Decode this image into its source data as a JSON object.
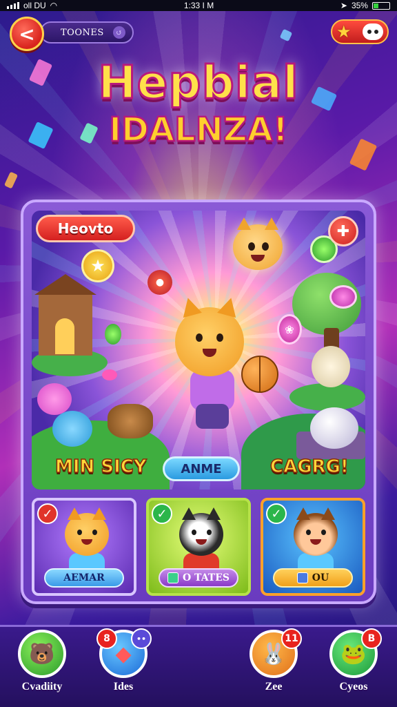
{
  "status_bar": {
    "left_text": "oll DU",
    "time": "1:33 I M",
    "battery": "35%",
    "battery_level": 0.35
  },
  "top_bar": {
    "back_symbol": "<",
    "pill_text": "TOONES",
    "pill_icon": "↺",
    "right_icons": [
      "star-icon",
      "face-icon"
    ]
  },
  "title": {
    "line1": "Hepbial",
    "line2": "IDALNZA!"
  },
  "scene": {
    "badge": "Heovto",
    "labels": {
      "left": "MIN SICY",
      "center": "ANME",
      "right": "CAGRG!"
    }
  },
  "cards": [
    {
      "button": "AEMAR",
      "check": "✓"
    },
    {
      "button": "O TATES",
      "check": "✓"
    },
    {
      "button": "OU",
      "check": "✓"
    }
  ],
  "bottom_nav": [
    {
      "label": "Cvadiity",
      "icon": "bear-icon"
    },
    {
      "label": "Ides",
      "icon": "puzzle-icon",
      "badge": "8"
    },
    {
      "label": "Zee",
      "icon": "bunny-icon",
      "badge": "11"
    },
    {
      "label": "Cyeos",
      "icon": "frog-icon",
      "badge": "B"
    }
  ],
  "colors": {
    "accent_red": "#e8231e",
    "title_yellow": "#ffe14a",
    "panel_purple": "#7a4ac8"
  }
}
